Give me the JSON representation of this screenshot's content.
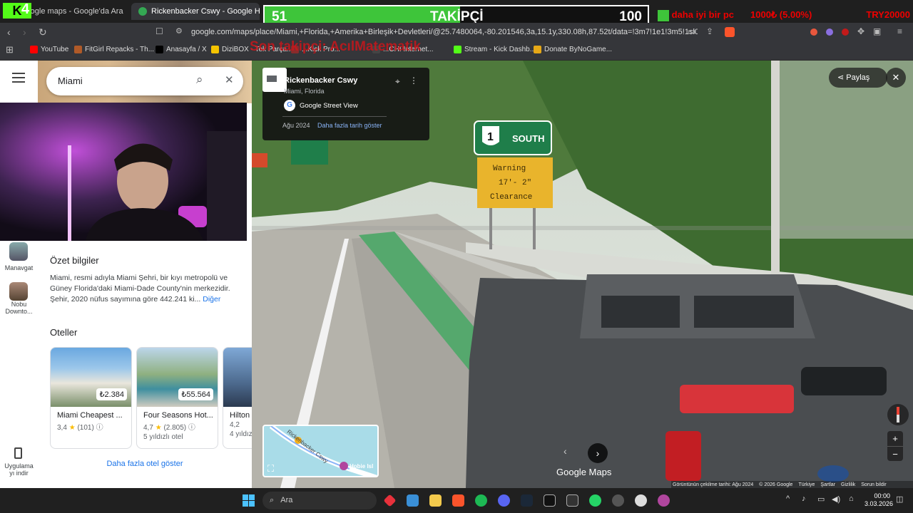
{
  "overlay": {
    "logo": "K",
    "logo_number": "4",
    "follower_current": "51",
    "follower_label": "TAKİPÇİ",
    "follower_goal": "100",
    "follower_progress": 0.51,
    "ticker_text": "daha iyi bir pc",
    "ticker_percent": "1000₺ (5.00%)",
    "ticker_goal": "TRY20000",
    "last_follower": "Son takipçi: AcılMatematik"
  },
  "browser": {
    "tabs": [
      {
        "label": "Google maps - Google'da Ara"
      },
      {
        "label": "Rickenbacker Cswy - Google Ha"
      }
    ],
    "url": "google.com/maps/place/Miami,+Florida,+Amerika+Birleşik+Devletleri/@25.7480064,-80.201546,3a,15.1y,330.08h,87.52t/data=!3m7!1e1!3m5!1sl0dlC...",
    "bookmarks": [
      {
        "label": "YouTube",
        "color": "#ff0000"
      },
      {
        "label": "FitGirl Repacks - Th...",
        "color": "#b05a28"
      },
      {
        "label": "Anasayfa / X",
        "color": "#000000"
      },
      {
        "label": "DiziBOX - Tek Parça...",
        "color": "#f5c400"
      },
      {
        "label": "...Kick Pro...",
        "color": "#8a2b2b"
      },
      {
        "label": "...CHI Internet...",
        "color": "#444444"
      },
      {
        "label": "Stream - Kick Dashb...",
        "color": "#53fc18"
      },
      {
        "label": "Donate ByNoGame...",
        "color": "#e6a817"
      }
    ]
  },
  "maps": {
    "search_value": "Miami",
    "rail": [
      {
        "label": "Manavgat"
      },
      {
        "label": "Nobu Downto..."
      },
      {
        "label": "Uygulama yı indir"
      }
    ],
    "overview_title": "Özet bilgiler",
    "overview_text": "Miami, resmi adıyla Miami Şehri, bir kıyı metropolü ve Güney Florida'daki Miami-Dade County'nin merkezidir. Şehir, 2020 nüfus sayımına göre 442.241 ki...",
    "overview_more": "Diğer",
    "hotels_title": "Oteller",
    "hotels": [
      {
        "name": "Miami Cheapest ...",
        "price": "₺2.384",
        "rating": "3,4",
        "reviews": "(101)",
        "stars": ""
      },
      {
        "name": "Four Seasons Hot...",
        "price": "₺55.564",
        "rating": "4,7",
        "reviews": "(2.805)",
        "stars": "5 yıldızlı otel"
      },
      {
        "name": "Hilton ...",
        "price": "",
        "rating": "4,2",
        "reviews": "",
        "stars": "4 yıldız..."
      }
    ],
    "hotels_more": "Daha fazla otel göster"
  },
  "streetview": {
    "place": "Rickenbacker Cswy",
    "place_sub": "Miami, Florida",
    "provider": "Google Street View",
    "date": "Ağu 2024",
    "more_dates": "Daha fazla tarih göster",
    "share": "Paylaş",
    "watermark": "Google Maps",
    "minimap_label": "Rickenbacker Cswy",
    "minimap_poi": "Hobie Isl",
    "sign_route": "1",
    "sign_dir": "SOUTH",
    "sign_warning": "Warning",
    "sign_height": "17'- 2\"",
    "sign_clearance": "Clearance",
    "footer": [
      "Görüntünün çekilme tarihi: Ağu 2024",
      "© 2026 Google",
      "Türkiye",
      "Şartlar",
      "Gizlilik",
      "Sorun bildir"
    ]
  },
  "taskbar": {
    "search_placeholder": "Ara",
    "time": "00:00",
    "date": "3.03.2026"
  }
}
